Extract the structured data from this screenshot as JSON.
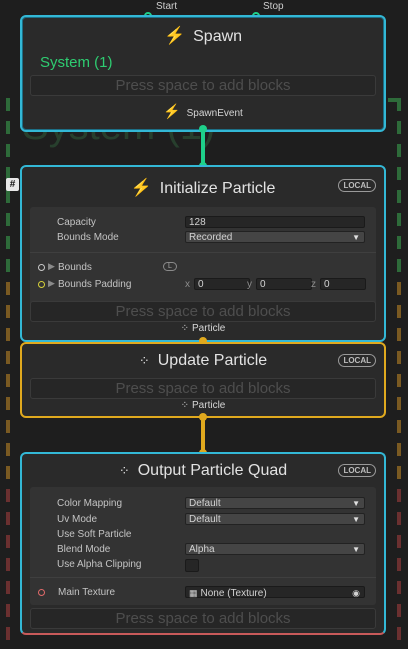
{
  "system_title": "System (1)",
  "spawn": {
    "title": "Spawn",
    "input_start": "Start",
    "input_stop": "Stop",
    "system_label": "System (1)",
    "drop_hint": "Press space to add blocks",
    "output_event": "SpawnEvent"
  },
  "init": {
    "title": "Initialize Particle",
    "badge": "LOCAL",
    "capacity_label": "Capacity",
    "capacity_value": "128",
    "bounds_mode_label": "Bounds Mode",
    "bounds_mode_value": "Recorded",
    "bounds_label": "Bounds",
    "bounds_space": "L",
    "bounds_padding_label": "Bounds Padding",
    "pad_x_label": "x",
    "pad_x": "0",
    "pad_y_label": "y",
    "pad_y": "0",
    "pad_z_label": "z",
    "pad_z": "0",
    "drop_hint": "Press space to add blocks",
    "flow_out": "Particle"
  },
  "update": {
    "title": "Update Particle",
    "badge": "LOCAL",
    "drop_hint": "Press space to add blocks",
    "flow_out": "Particle"
  },
  "output": {
    "title": "Output Particle Quad",
    "badge": "LOCAL",
    "color_mapping_label": "Color Mapping",
    "color_mapping_value": "Default",
    "uv_mode_label": "Uv Mode",
    "uv_mode_value": "Default",
    "soft_particle_label": "Use Soft Particle",
    "blend_mode_label": "Blend Mode",
    "blend_mode_value": "Alpha",
    "alpha_clip_label": "Use Alpha Clipping",
    "main_texture_label": "Main Texture",
    "main_texture_value": "None (Texture)",
    "drop_hint": "Press space to add blocks"
  },
  "colors": {
    "context_border": "#33b8d6",
    "flow_link": "#e0a91e",
    "event_link": "#1ed08a",
    "system_green": "#2ecc71"
  },
  "icons": [
    "lightning-icon",
    "particle-icon",
    "dropdown-arrow-icon",
    "texture-icon",
    "object-picker-icon",
    "foldout-arrow-icon",
    "hash-icon"
  ]
}
